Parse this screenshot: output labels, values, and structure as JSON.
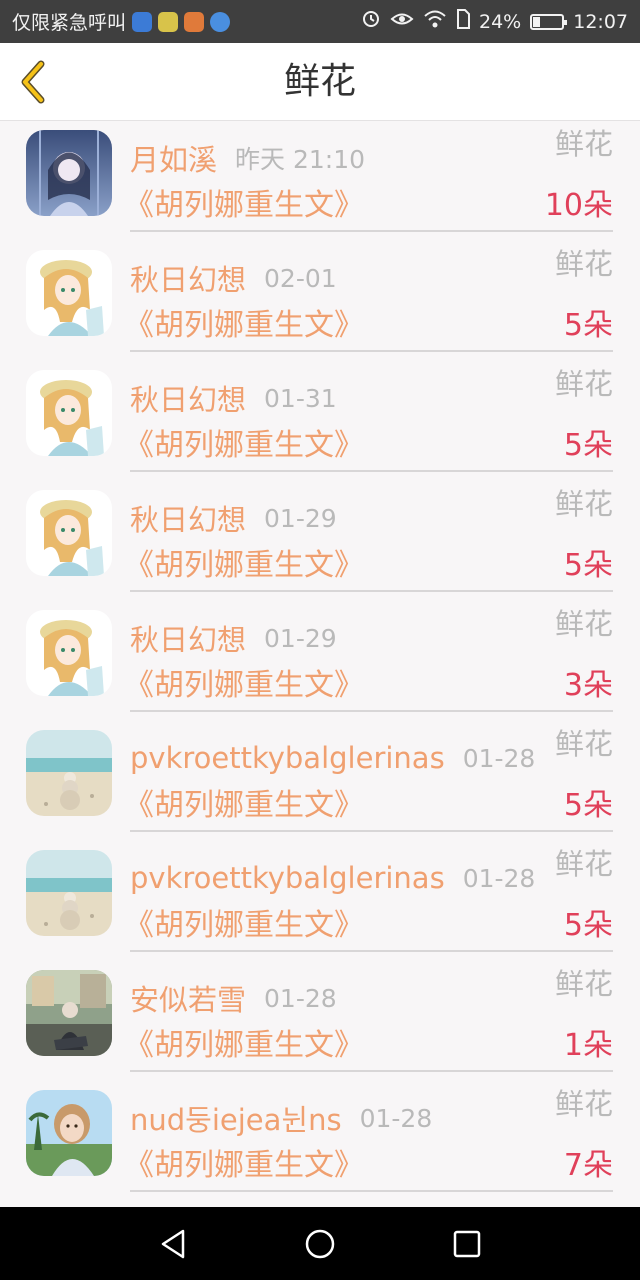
{
  "status_bar": {
    "carrier_text": "仅限紧急呼叫",
    "battery": "24%",
    "time": "12:07",
    "battery_level": 0.24
  },
  "header": {
    "title": "鲜花"
  },
  "items": [
    {
      "name": "月如溪",
      "time": "昨天 21:10",
      "type": "鲜花",
      "book": "《胡列娜重生文》",
      "count": "10朵",
      "avatar": "anime-dark"
    },
    {
      "name": "秋日幻想",
      "time": "02-01",
      "type": "鲜花",
      "book": "《胡列娜重生文》",
      "count": "5朵",
      "avatar": "anime-girl"
    },
    {
      "name": "秋日幻想",
      "time": "01-31",
      "type": "鲜花",
      "book": "《胡列娜重生文》",
      "count": "5朵",
      "avatar": "anime-girl"
    },
    {
      "name": "秋日幻想",
      "time": "01-29",
      "type": "鲜花",
      "book": "《胡列娜重生文》",
      "count": "5朵",
      "avatar": "anime-girl"
    },
    {
      "name": "秋日幻想",
      "time": "01-29",
      "type": "鲜花",
      "book": "《胡列娜重生文》",
      "count": "3朵",
      "avatar": "anime-girl"
    },
    {
      "name": "pvkroettkybalglerinas",
      "time": "01-28",
      "type": "鲜花",
      "book": "《胡列娜重生文》",
      "count": "5朵",
      "avatar": "beach"
    },
    {
      "name": "pvkroettkybalglerinas",
      "time": "01-28",
      "type": "鲜花",
      "book": "《胡列娜重生文》",
      "count": "5朵",
      "avatar": "beach"
    },
    {
      "name": "安似若雪",
      "time": "01-28",
      "type": "鲜花",
      "book": "《胡列娜重生文》",
      "count": "1朵",
      "avatar": "street"
    },
    {
      "name": "nud둥iejea뉜ns",
      "time": "01-28",
      "type": "鲜花",
      "book": "《胡列娜重生文》",
      "count": "7朵",
      "avatar": "child"
    }
  ]
}
